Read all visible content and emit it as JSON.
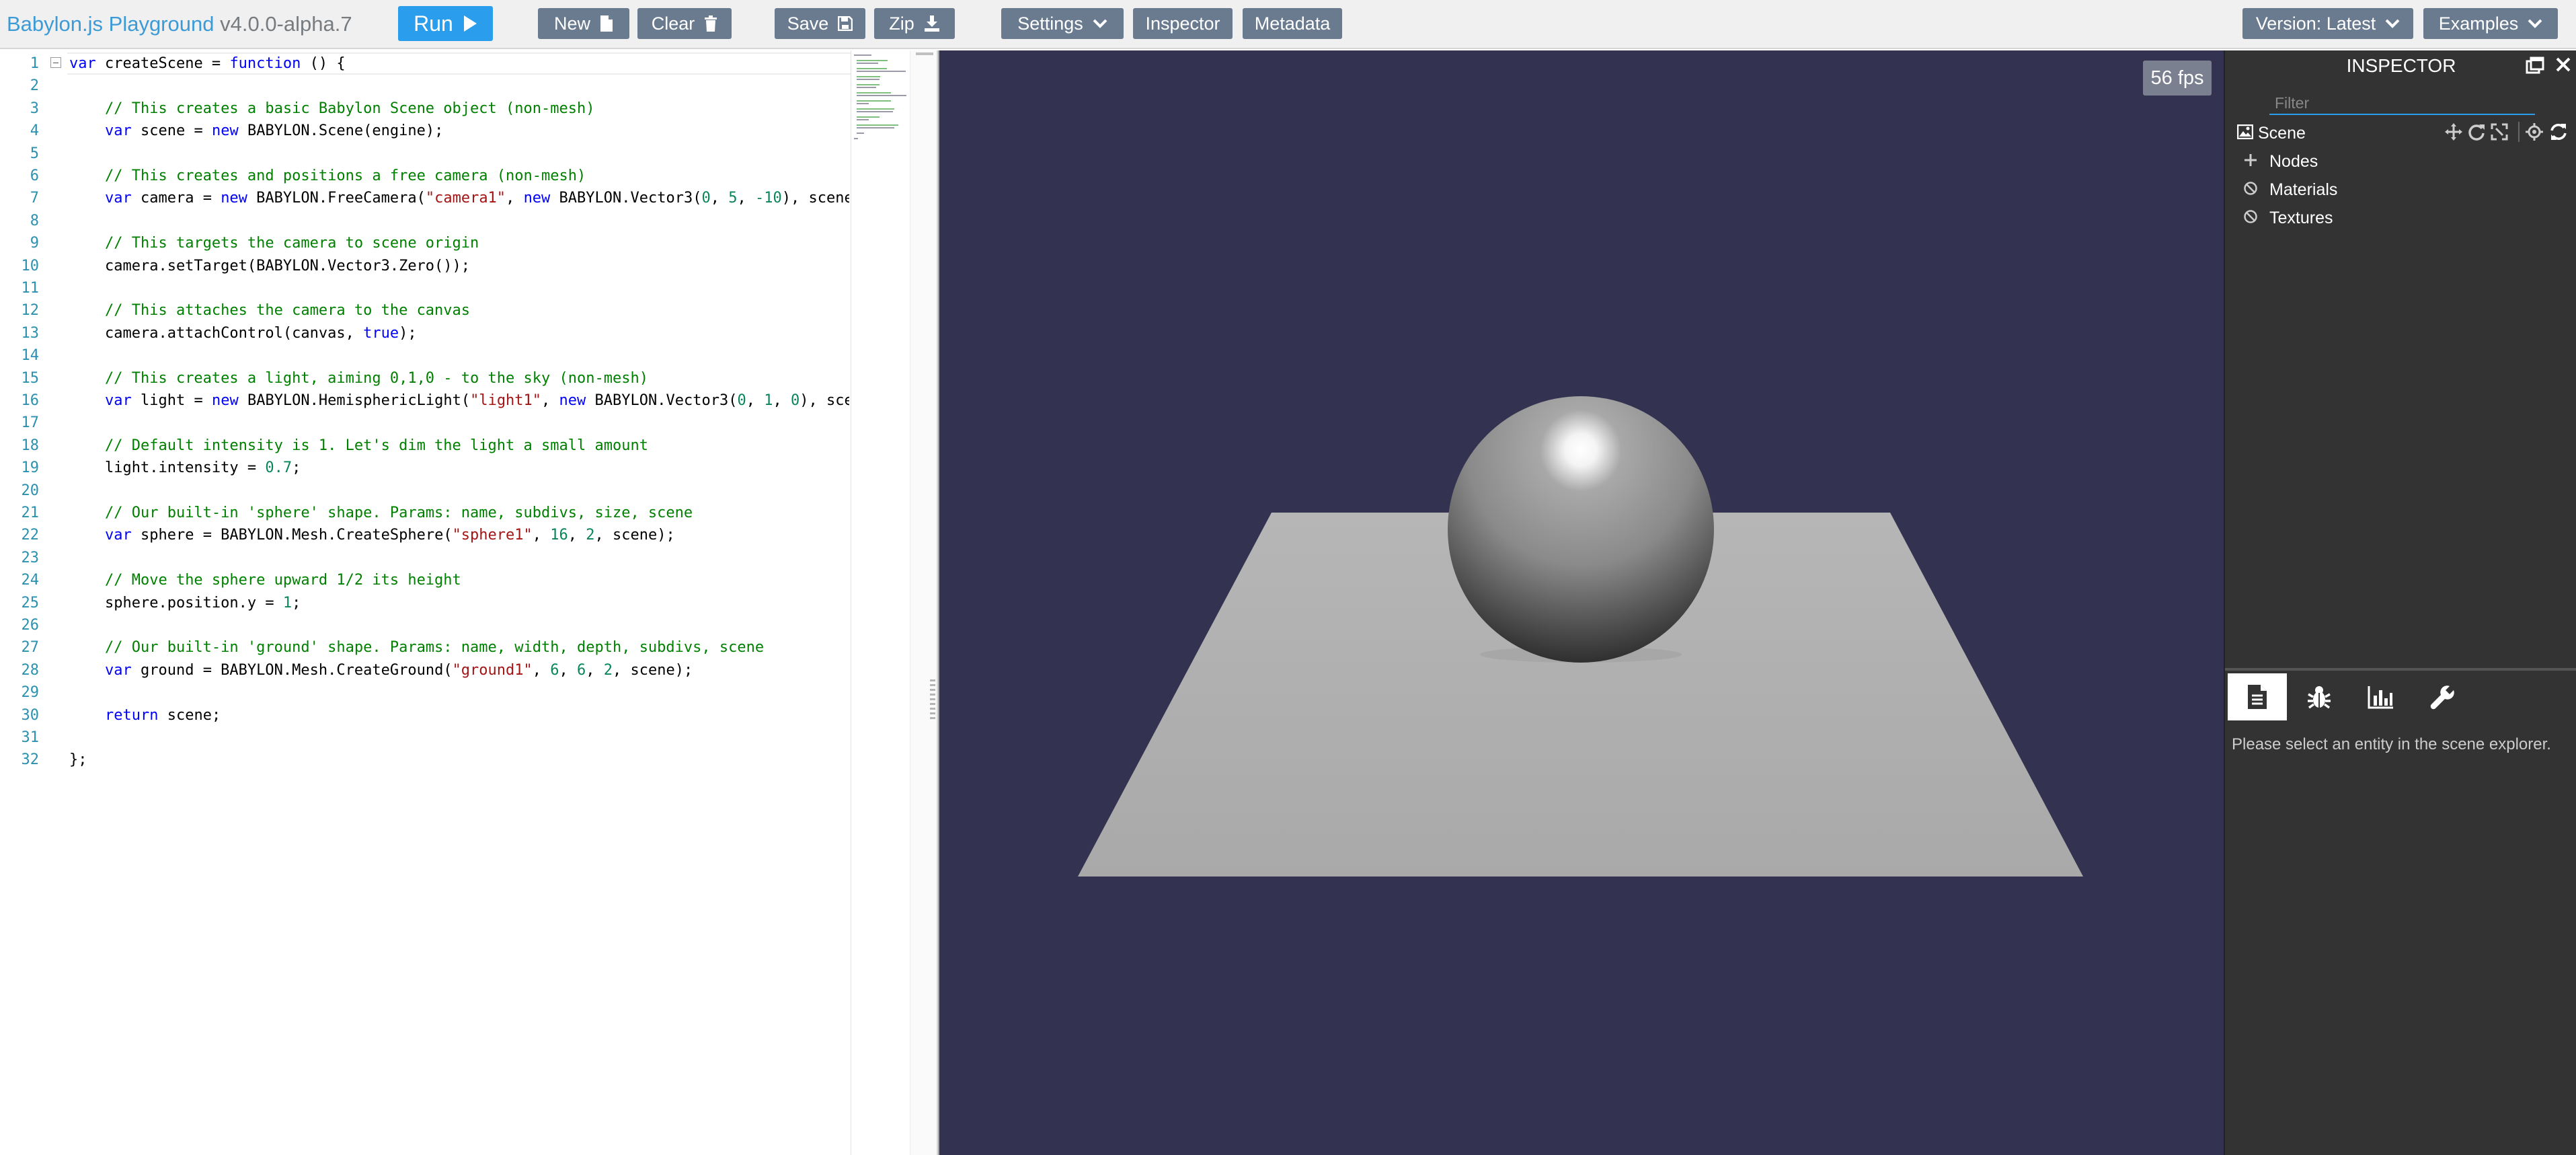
{
  "menubar": {
    "brand": "Babylon.js Playground",
    "version": "v4.0.0-alpha.7",
    "run_label": "Run",
    "new_label": "New",
    "clear_label": "Clear",
    "save_label": "Save",
    "zip_label": "Zip",
    "settings_label": "Settings",
    "inspector_label": "Inspector",
    "metadata_label": "Metadata",
    "version_select_label": "Version: Latest",
    "examples_label": "Examples"
  },
  "editor": {
    "line_numbers": [
      "1",
      "2",
      "3",
      "4",
      "5",
      "6",
      "7",
      "8",
      "9",
      "10",
      "11",
      "12",
      "13",
      "14",
      "15",
      "16",
      "17",
      "18",
      "19",
      "20",
      "21",
      "22",
      "23",
      "24",
      "25",
      "26",
      "27",
      "28",
      "29",
      "30",
      "31",
      "32"
    ],
    "lines": [
      [
        {
          "t": "var",
          "c": "kw"
        },
        {
          "t": " createScene = "
        },
        {
          "t": "function",
          "c": "kw"
        },
        {
          "t": " () {"
        }
      ],
      [],
      [
        {
          "t": "    "
        },
        {
          "t": "// This creates a basic Babylon Scene object (non-mesh)",
          "c": "cm"
        }
      ],
      [
        {
          "t": "    "
        },
        {
          "t": "var",
          "c": "kw"
        },
        {
          "t": " scene = "
        },
        {
          "t": "new",
          "c": "kw"
        },
        {
          "t": " BABYLON.Scene(engine);"
        }
      ],
      [],
      [
        {
          "t": "    "
        },
        {
          "t": "// This creates and positions a free camera (non-mesh)",
          "c": "cm"
        }
      ],
      [
        {
          "t": "    "
        },
        {
          "t": "var",
          "c": "kw"
        },
        {
          "t": " camera = "
        },
        {
          "t": "new",
          "c": "kw"
        },
        {
          "t": " BABYLON.FreeCamera("
        },
        {
          "t": "\"camera1\"",
          "c": "st"
        },
        {
          "t": ", "
        },
        {
          "t": "new",
          "c": "kw"
        },
        {
          "t": " BABYLON.Vector3("
        },
        {
          "t": "0",
          "c": "nm"
        },
        {
          "t": ", "
        },
        {
          "t": "5",
          "c": "nm"
        },
        {
          "t": ", "
        },
        {
          "t": "-10",
          "c": "nm"
        },
        {
          "t": "), scene);"
        }
      ],
      [],
      [
        {
          "t": "    "
        },
        {
          "t": "// This targets the camera to scene origin",
          "c": "cm"
        }
      ],
      [
        {
          "t": "    camera.setTarget(BABYLON.Vector3.Zero());"
        }
      ],
      [],
      [
        {
          "t": "    "
        },
        {
          "t": "// This attaches the camera to the canvas",
          "c": "cm"
        }
      ],
      [
        {
          "t": "    camera.attachControl(canvas, "
        },
        {
          "t": "true",
          "c": "kw"
        },
        {
          "t": ");"
        }
      ],
      [],
      [
        {
          "t": "    "
        },
        {
          "t": "// This creates a light, aiming 0,1,0 - to the sky (non-mesh)",
          "c": "cm"
        }
      ],
      [
        {
          "t": "    "
        },
        {
          "t": "var",
          "c": "kw"
        },
        {
          "t": " light = "
        },
        {
          "t": "new",
          "c": "kw"
        },
        {
          "t": " BABYLON.HemisphericLight("
        },
        {
          "t": "\"light1\"",
          "c": "st"
        },
        {
          "t": ", "
        },
        {
          "t": "new",
          "c": "kw"
        },
        {
          "t": " BABYLON.Vector3("
        },
        {
          "t": "0",
          "c": "nm"
        },
        {
          "t": ", "
        },
        {
          "t": "1",
          "c": "nm"
        },
        {
          "t": ", "
        },
        {
          "t": "0",
          "c": "nm"
        },
        {
          "t": "), scene);"
        }
      ],
      [],
      [
        {
          "t": "    "
        },
        {
          "t": "// Default intensity is 1. Let's dim the light a small amount",
          "c": "cm"
        }
      ],
      [
        {
          "t": "    light.intensity = "
        },
        {
          "t": "0.7",
          "c": "nm"
        },
        {
          "t": ";"
        }
      ],
      [],
      [
        {
          "t": "    "
        },
        {
          "t": "// Our built-in 'sphere' shape. Params: name, subdivs, size, scene",
          "c": "cm"
        }
      ],
      [
        {
          "t": "    "
        },
        {
          "t": "var",
          "c": "kw"
        },
        {
          "t": " sphere = BABYLON.Mesh.CreateSphere("
        },
        {
          "t": "\"sphere1\"",
          "c": "st"
        },
        {
          "t": ", "
        },
        {
          "t": "16",
          "c": "nm"
        },
        {
          "t": ", "
        },
        {
          "t": "2",
          "c": "nm"
        },
        {
          "t": ", scene);"
        }
      ],
      [],
      [
        {
          "t": "    "
        },
        {
          "t": "// Move the sphere upward 1/2 its height",
          "c": "cm"
        }
      ],
      [
        {
          "t": "    sphere.position.y = "
        },
        {
          "t": "1",
          "c": "nm"
        },
        {
          "t": ";"
        }
      ],
      [],
      [
        {
          "t": "    "
        },
        {
          "t": "// Our built-in 'ground' shape. Params: name, width, depth, subdivs, scene",
          "c": "cm"
        }
      ],
      [
        {
          "t": "    "
        },
        {
          "t": "var",
          "c": "kw"
        },
        {
          "t": " ground = BABYLON.Mesh.CreateGround("
        },
        {
          "t": "\"ground1\"",
          "c": "st"
        },
        {
          "t": ", "
        },
        {
          "t": "6",
          "c": "nm"
        },
        {
          "t": ", "
        },
        {
          "t": "6",
          "c": "nm"
        },
        {
          "t": ", "
        },
        {
          "t": "2",
          "c": "nm"
        },
        {
          "t": ", scene);"
        }
      ],
      [],
      [
        {
          "t": "    "
        },
        {
          "t": "return",
          "c": "kw"
        },
        {
          "t": " scene;"
        }
      ],
      [],
      [
        {
          "t": "};"
        }
      ]
    ]
  },
  "viewport": {
    "fps": "56 fps",
    "background_color": "#333351"
  },
  "inspector": {
    "title": "INSPECTOR",
    "filter_placeholder": "Filter",
    "tree": {
      "scene_label": "Scene",
      "nodes_label": "Nodes",
      "materials_label": "Materials",
      "textures_label": "Textures"
    },
    "tabs": [
      "properties",
      "debug",
      "statistics",
      "tools"
    ],
    "empty_hint": "Please select an entity in the scene explorer."
  },
  "colors": {
    "accent": "#2a9dec",
    "button": "#6a7b8f",
    "brand": "#3c9bd6",
    "inspector_bg": "#333333"
  }
}
